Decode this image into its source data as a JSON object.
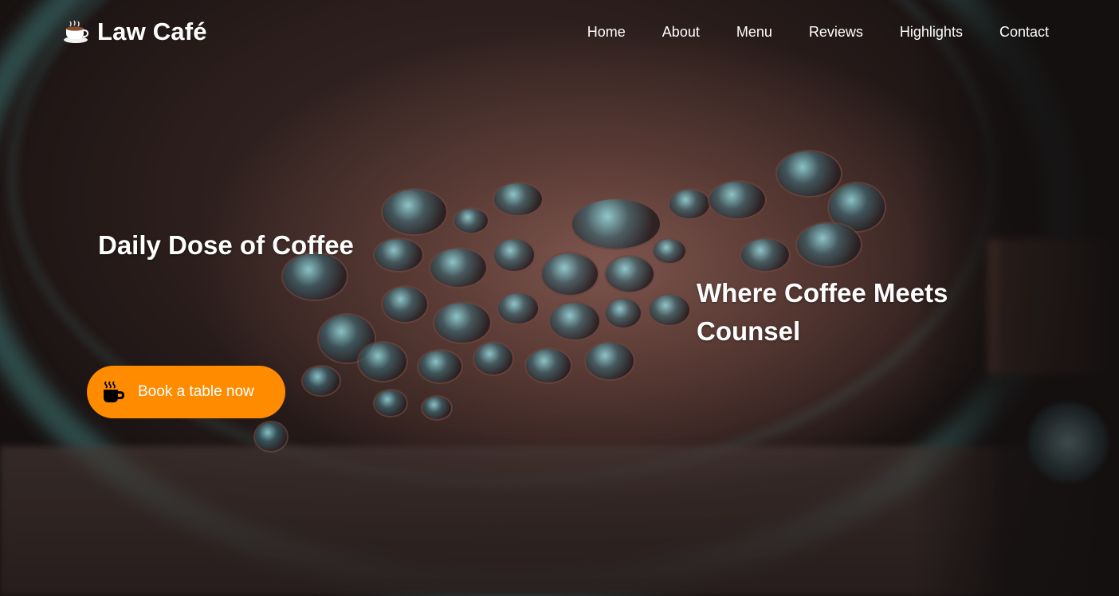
{
  "brand": {
    "name": "Law Café",
    "icon": "coffee-cup-icon"
  },
  "nav": {
    "items": [
      {
        "label": "Home"
      },
      {
        "label": "About"
      },
      {
        "label": "Menu"
      },
      {
        "label": "Reviews"
      },
      {
        "label": "Highlights"
      },
      {
        "label": "Contact"
      }
    ]
  },
  "hero": {
    "headline_left": "Daily Dose of Coffee",
    "headline_right": "Where Coffee Meets Counsel",
    "cta": {
      "label": "Book a table now",
      "icon": "coffee-mug-icon",
      "color": "#ff8c00"
    }
  }
}
